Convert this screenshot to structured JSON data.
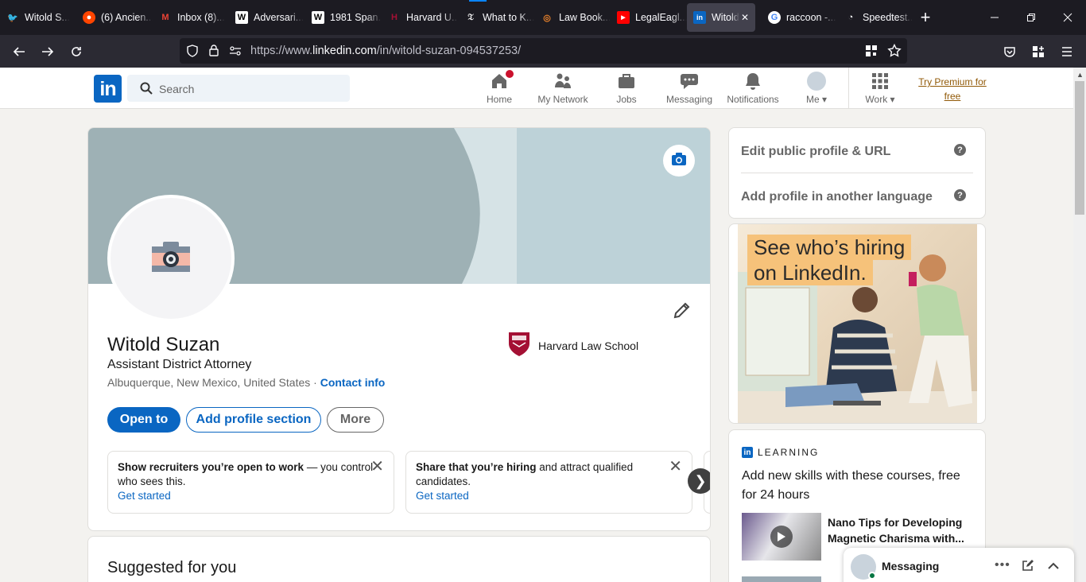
{
  "browser": {
    "tabs": [
      {
        "title": "Witold S...",
        "icon": "twitter-icon",
        "color": "#1d9bf0"
      },
      {
        "title": "(6) Ancien...",
        "icon": "reddit-icon",
        "color": "#ff4500"
      },
      {
        "title": "Inbox (8)...",
        "icon": "gmail-icon",
        "color": "#ea4335"
      },
      {
        "title": "Adversari...",
        "icon": "wikipedia-icon",
        "color": "#ffffff"
      },
      {
        "title": "1981 Span...",
        "icon": "wikipedia-icon",
        "color": "#ffffff"
      },
      {
        "title": "Harvard U...",
        "icon": "harvard-icon",
        "color": "#a41034"
      },
      {
        "title": "What to K...",
        "icon": "nytimes-icon",
        "color": "#ffffff"
      },
      {
        "title": "Law Book...",
        "icon": "lawbook-icon",
        "color": "#e8812b"
      },
      {
        "title": "LegalEagl...",
        "icon": "youtube-icon",
        "color": "#ff0000"
      },
      {
        "title": "Witold",
        "icon": "linkedin-icon",
        "color": "#0a66c2",
        "active": true
      },
      {
        "title": "raccoon -...",
        "icon": "google-icon",
        "color": "#4285f4"
      },
      {
        "title": "Speedtest...",
        "icon": "speedtest-icon",
        "color": "#ffffff"
      }
    ],
    "url_prefix": "https://www.",
    "url_domain": "linkedin.com",
    "url_path": "/in/witold-suzan-094537253/"
  },
  "header": {
    "logo": "in",
    "search_placeholder": "Search",
    "nav": [
      {
        "label": "Home",
        "icon": "home-icon"
      },
      {
        "label": "My Network",
        "icon": "network-icon"
      },
      {
        "label": "Jobs",
        "icon": "briefcase-icon"
      },
      {
        "label": "Messaging",
        "icon": "messaging-icon"
      },
      {
        "label": "Notifications",
        "icon": "bell-icon"
      },
      {
        "label": "Me",
        "icon": "avatar"
      },
      {
        "label": "Work",
        "icon": "grid-icon"
      }
    ],
    "premium": "Try Premium for free"
  },
  "profile": {
    "name": "Witold Suzan",
    "headline": "Assistant District Attorney",
    "location": "Albuquerque, New Mexico, United States",
    "separator": " · ",
    "contact": "Contact info",
    "school": "Harvard Law School",
    "buttons": {
      "open": "Open to",
      "add": "Add profile section",
      "more": "More"
    },
    "promos": [
      {
        "bold": "Show recruiters you’re open to work",
        "rest": " — you control who sees this.",
        "link": "Get started"
      },
      {
        "bold": "Share that you’re hiring",
        "rest": " and attract qualified candidates.",
        "link": "Get started"
      }
    ],
    "next_arrow": "❯"
  },
  "suggested": {
    "title": "Suggested for you"
  },
  "sidebar": {
    "edit_public": "Edit public profile & URL",
    "add_language": "Add profile in another language",
    "qmark": "?",
    "ad_line1": "See who’s hiring",
    "ad_line2": "on LinkedIn.",
    "learning_brand": "LEARNING",
    "learning_title": "Add new skills with these courses, free for 24 hours",
    "course_title": "Nano Tips for Developing Magnetic Charisma with..."
  },
  "messaging": {
    "label": "Messaging"
  },
  "colors": {
    "linkedin_blue": "#0a66c2",
    "premium": "#915907",
    "banner": "#9eb1b5"
  }
}
